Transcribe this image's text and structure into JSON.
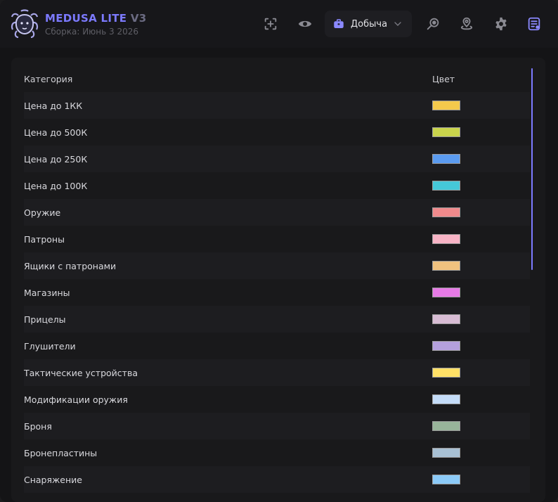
{
  "app": {
    "title": "MEDUSA LITE",
    "version": "V3",
    "build": "Сборка: Июнь 3 2026"
  },
  "toolbar": {
    "icons": [
      "crosshair-add-icon",
      "eye-icon"
    ],
    "dropdown": {
      "label": "Добыча",
      "icon": "briefcase-icon"
    },
    "right_icons": [
      "radar-search-icon",
      "location-pin-icon",
      "gear-icon",
      "notes-icon"
    ]
  },
  "table": {
    "headers": {
      "category": "Категория",
      "color": "Цвет"
    },
    "rows": [
      {
        "label": "Цена до 1КК",
        "color": "#f4c94c"
      },
      {
        "label": "Цена до 500К",
        "color": "#c9d44c"
      },
      {
        "label": "Цена до 250К",
        "color": "#5b9bf0"
      },
      {
        "label": "Цена до 100К",
        "color": "#45c8d8"
      },
      {
        "label": "Оружие",
        "color": "#f08a8c"
      },
      {
        "label": "Патроны",
        "color": "#f8b4c6"
      },
      {
        "label": "Ящики с патронами",
        "color": "#f0c27f"
      },
      {
        "label": "Магазины",
        "color": "#e67ae6"
      },
      {
        "label": "Прицелы",
        "color": "#d8bcd4"
      },
      {
        "label": "Глушители",
        "color": "#b4a0dc"
      },
      {
        "label": "Тактические устройства",
        "color": "#ffe066"
      },
      {
        "label": "Модификации оружия",
        "color": "#c4dcf8"
      },
      {
        "label": "Броня",
        "color": "#98b49a"
      },
      {
        "label": "Бронепластины",
        "color": "#a8c0d4"
      },
      {
        "label": "Снаряжение",
        "color": "#8ccaf8"
      }
    ]
  },
  "colors": {
    "accent": "#7c7aff"
  }
}
